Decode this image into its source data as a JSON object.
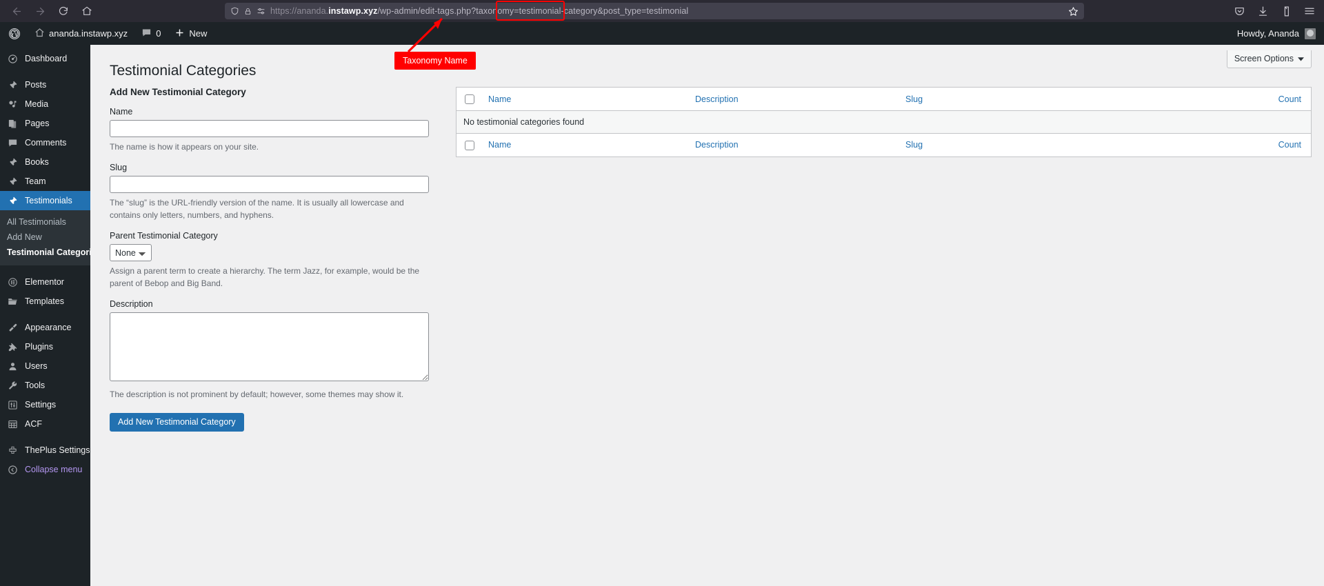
{
  "browser": {
    "nav": {
      "back_icon": "back-arrow-icon",
      "forward_icon": "forward-arrow-icon",
      "reload_icon": "reload-icon",
      "home_icon": "home-icon"
    },
    "url": {
      "scheme": "https://",
      "host_prefix": "ananda.",
      "host_strong": "instawp.xyz",
      "path": "/wp-admin/edit-tags.php?taxonomy=",
      "highlighted": "testimonial-category",
      "path_tail": "&post_type=testimonial",
      "full": "https://ananda.instawp.xyz/wp-admin/edit-tags.php?taxonomy=testimonial-category&post_type=testimonial"
    },
    "icons": {
      "shield": "shield-icon",
      "lock": "lock-icon",
      "permissions": "site-permissions-icon",
      "bookmark": "star-bookmark-icon",
      "pocket": "pocket-icon",
      "downloads": "downloads-icon",
      "account": "account-icon",
      "menu": "hamburger-menu-icon"
    }
  },
  "adminbar": {
    "wp_logo": "wordpress-logo-icon",
    "site_name": "ananda.instawp.xyz",
    "site_icon": "home-icon",
    "comments_icon": "comment-bubble-icon",
    "comments_count": "0",
    "new_icon": "plus-icon",
    "new_label": "New",
    "howdy": "Howdy, Ananda",
    "avatar": "user-avatar"
  },
  "sidebar": {
    "items": [
      {
        "label": "Dashboard",
        "icon": "dashboard-icon",
        "current": false
      },
      {
        "label": "Posts",
        "icon": "pin-icon",
        "current": false
      },
      {
        "label": "Media",
        "icon": "media-icon",
        "current": false
      },
      {
        "label": "Pages",
        "icon": "pages-icon",
        "current": false
      },
      {
        "label": "Comments",
        "icon": "comment-bubble-icon",
        "current": false
      },
      {
        "label": "Books",
        "icon": "pin-icon",
        "current": false
      },
      {
        "label": "Team",
        "icon": "pin-icon",
        "current": false
      },
      {
        "label": "Testimonials",
        "icon": "pin-icon",
        "current": true
      }
    ],
    "submenu": [
      {
        "label": "All Testimonials",
        "current": false
      },
      {
        "label": "Add New",
        "current": false
      },
      {
        "label": "Testimonial Categories",
        "current": true
      }
    ],
    "items2": [
      {
        "label": "Elementor",
        "icon": "elementor-icon"
      },
      {
        "label": "Templates",
        "icon": "folder-icon"
      }
    ],
    "items3": [
      {
        "label": "Appearance",
        "icon": "paintbrush-icon"
      },
      {
        "label": "Plugins",
        "icon": "plug-icon"
      },
      {
        "label": "Users",
        "icon": "user-icon"
      },
      {
        "label": "Tools",
        "icon": "wrench-icon"
      },
      {
        "label": "Settings",
        "icon": "sliders-icon"
      },
      {
        "label": "ACF",
        "icon": "acf-grid-icon"
      }
    ],
    "items4": [
      {
        "label": "ThePlus Settings",
        "icon": "theplus-icon"
      }
    ],
    "collapse": {
      "label": "Collapse menu",
      "icon": "collapse-arrow-icon"
    }
  },
  "screen_options": {
    "label": "Screen Options",
    "chevron": "chevron-down-icon"
  },
  "page": {
    "title": "Testimonial Categories"
  },
  "form": {
    "heading": "Add New Testimonial Category",
    "name": {
      "label": "Name",
      "value": "",
      "placeholder": "",
      "hint": "The name is how it appears on your site."
    },
    "slug": {
      "label": "Slug",
      "value": "",
      "placeholder": "",
      "hint": "The “slug” is the URL-friendly version of the name. It is usually all lowercase and contains only letters, numbers, and hyphens."
    },
    "parent": {
      "label": "Parent Testimonial Category",
      "selected": "None",
      "options": [
        "None"
      ],
      "hint": "Assign a parent term to create a hierarchy. The term Jazz, for example, would be the parent of Bebop and Big Band."
    },
    "description": {
      "label": "Description",
      "value": "",
      "placeholder": "",
      "hint": "The description is not prominent by default; however, some themes may show it."
    },
    "submit_label": "Add New Testimonial Category"
  },
  "table": {
    "columns": [
      "Name",
      "Description",
      "Slug",
      "Count"
    ],
    "select_all_checkbox": "select-all-checkbox",
    "empty_message": "No testimonial categories found",
    "rows": []
  },
  "annotation": {
    "callout_text": "Taxonomy Name",
    "color": "#ff0000"
  },
  "colors": {
    "wp_blue": "#2271b1",
    "admin_dark": "#1d2327",
    "submenu_dark": "#2c3338",
    "content_bg": "#f0f0f1",
    "annotation_red": "#ff0000",
    "browser_chrome": "#2b2a33"
  }
}
